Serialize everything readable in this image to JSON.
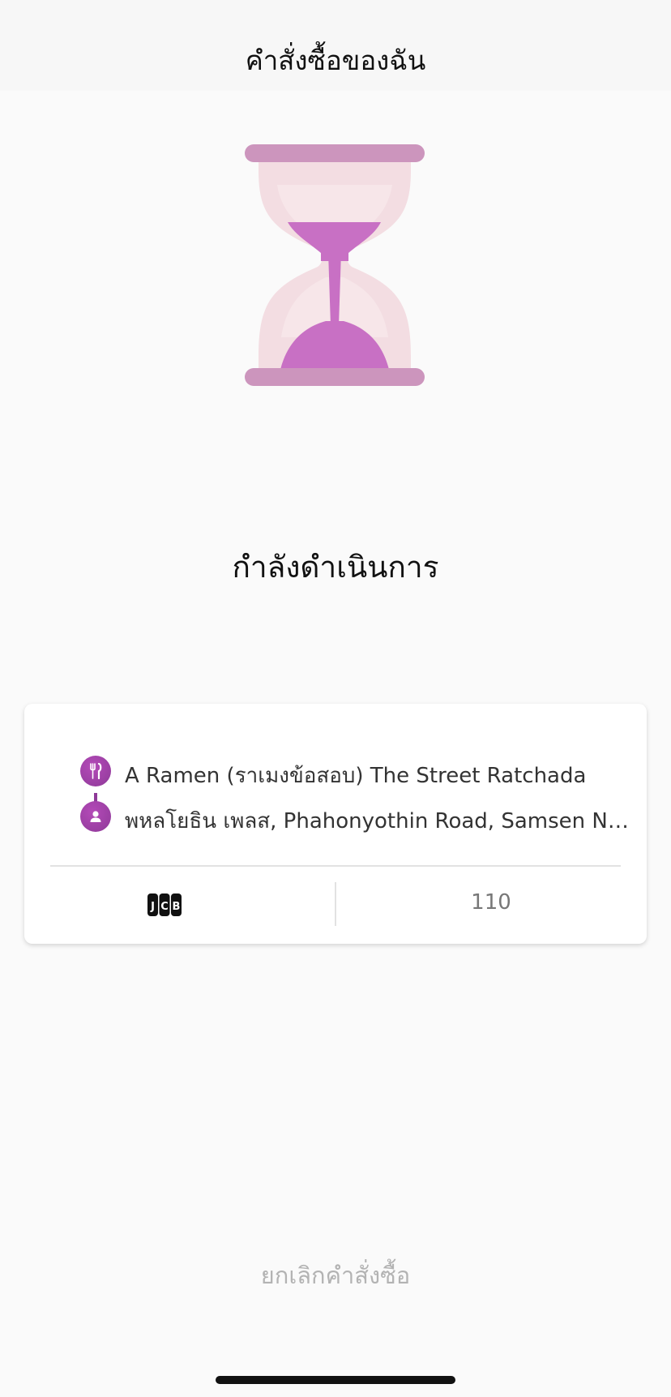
{
  "header": {
    "title": "คำสั่งซื้อของฉัน"
  },
  "status": {
    "icon": "hourglass-icon",
    "title": "กำลังดำเนินการ"
  },
  "order_card": {
    "restaurant": {
      "icon": "utensils-icon",
      "name": "A Ramen (ราเมงข้อสอบ) The Street Ratchada"
    },
    "delivery": {
      "icon": "person-icon",
      "address": "พหลโยธิน เพลส, Phahonyothin Road, Samsen Nai, Phaya Thai"
    },
    "payment": {
      "icon": "jcb-card-icon",
      "method": "JCB"
    },
    "price": "110"
  },
  "actions": {
    "cancel_label": "ยกเลิกคำสั่งซื้อ"
  },
  "colors": {
    "accent": "#8e3a98",
    "hourglass_frame": "#cc95bd",
    "hourglass_sand": "#c870c4",
    "hourglass_glass": "#f3dde2"
  }
}
